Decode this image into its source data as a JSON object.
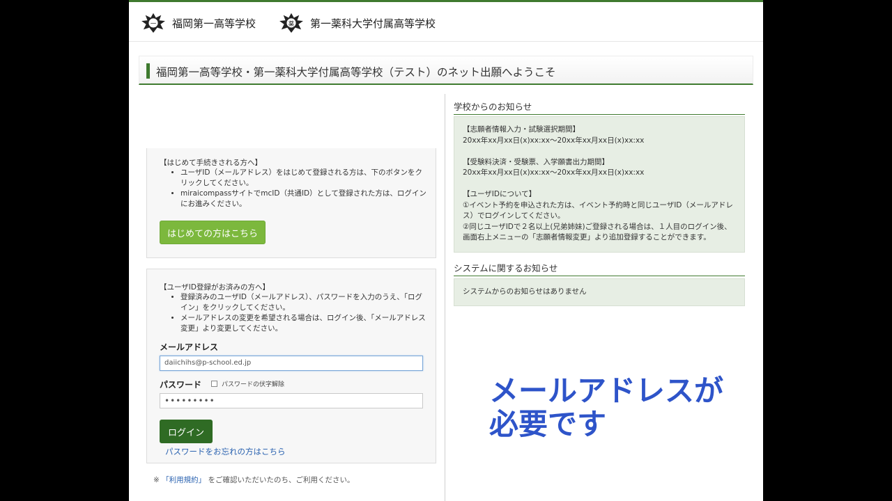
{
  "header": {
    "school1": "福岡第一高等学校",
    "school2": "第一薬科大学付属高等学校"
  },
  "welcome": {
    "title": "福岡第一高等学校・第一薬科大学付属高等学校（テスト）のネット出願へようこそ"
  },
  "first_time": {
    "heading": "【はじめて手続きされる方へ】",
    "notes": [
      "ユーザID（メールアドレス）をはじめて登録される方は、下のボタンをクリックしてください。",
      "miraicompassサイトでmcID（共通ID）として登録された方は、ログインにお進みください。"
    ],
    "button_label": "はじめての方はこちら"
  },
  "login": {
    "heading": "【ユーザID登録がお済みの方へ】",
    "notes": [
      "登録済みのユーザID（メールアドレス）、パスワードを入力のうえ、「ログイン」をクリックしてください。",
      "メールアドレスの変更を希望される場合は、ログイン後、「メールアドレス変更」より変更してください。"
    ],
    "email_label": "メールアドレス",
    "email_value": "daiichihs@p-school.ed.jp",
    "password_label": "パスワード",
    "password_toggle_label": "パスワードの伏字解除",
    "password_value": "•••••••••",
    "login_button": "ログイン",
    "forgot_link": "パスワードをお忘れの方はこちら"
  },
  "terms": {
    "prefix": "※",
    "link": "「利用規約」",
    "suffix": "をご確認いただいたのち、ご利用ください。"
  },
  "school_news": {
    "title": "学校からのお知らせ",
    "lines": [
      "【志願者情報入力・試験選択期間】",
      "20xx年xx月xx日(x)xx:xx～20xx年xx月xx日(x)xx:xx",
      "【受験料決済・受験票、入学願書出力期間】",
      "20xx年xx月xx日(x)xx:xx～20xx年xx月xx日(x)xx:xx",
      "【ユーザIDについて】",
      "①イベント予約を申込された方は、イベント予約時と同じユーザID（メールアドレス）でログインしてください。",
      "②同じユーザIDで２名以上(兄弟姉妹)ご登録される場合は、１人目のログイン後、画面右上メニューの「志願者情報変更」より追加登録することができます。"
    ]
  },
  "system_news": {
    "title": "システムに関するお知らせ",
    "message": "システムからのお知らせはありません"
  },
  "overlay": {
    "line1": "メールアドレスが",
    "line2": "必要です"
  },
  "colors": {
    "brand_green": "#3f7a2f",
    "first_button": "#7cb83d",
    "login_button": "#2f6b24",
    "link": "#2a62b0",
    "overlay_text": "#2e54c9"
  }
}
